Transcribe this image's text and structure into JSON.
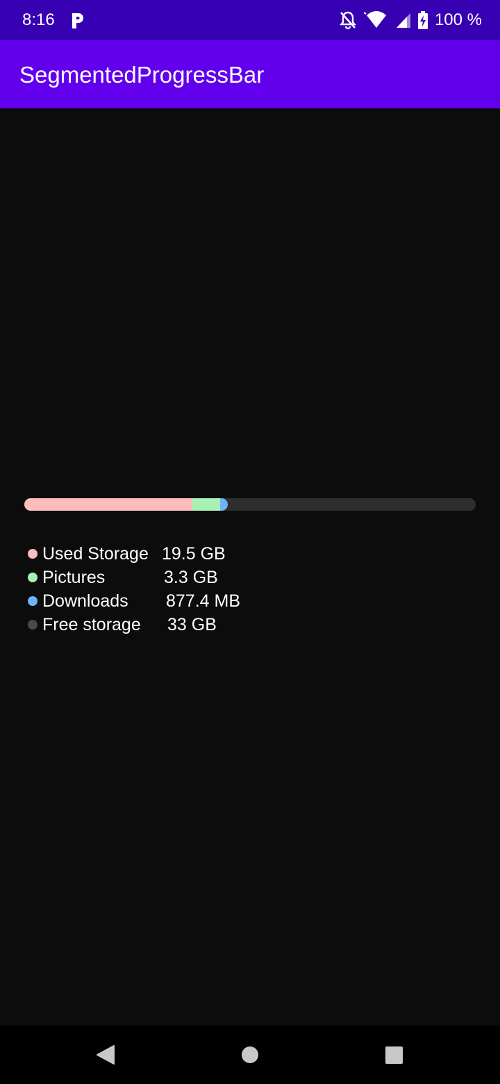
{
  "status_bar": {
    "time": "8:16",
    "battery": "100 %",
    "icons": [
      "parking-icon",
      "notifications-off-icon",
      "wifi-icon",
      "signal-icon",
      "battery-charging-icon"
    ]
  },
  "app_bar": {
    "title": "SegmentedProgressBar",
    "color": "#6200ee",
    "status_color": "#3700b3"
  },
  "progress": {
    "segments": [
      {
        "name": "Used Storage",
        "fraction": 0.3716,
        "color": "#ffbcbc"
      },
      {
        "name": "Pictures",
        "fraction": 0.0629,
        "color": "#a8f0b4"
      },
      {
        "name": "Downloads",
        "fraction": 0.0167,
        "color": "#6fb3f7"
      },
      {
        "name": "Free storage",
        "fraction": 0.6289,
        "color": "#2e2e2e"
      }
    ]
  },
  "legend": {
    "items": [
      {
        "label": "Used Storage",
        "value": "19.5 GB",
        "color": "#ffbcbc"
      },
      {
        "label": "Pictures",
        "value": "3.3 GB",
        "color": "#a8f0b4"
      },
      {
        "label": "Downloads",
        "value": "877.4 MB",
        "color": "#6fb3f7"
      },
      {
        "label": "Free storage",
        "value": "33 GB",
        "color": "#4a4a4a"
      }
    ]
  },
  "nav_bar": {
    "buttons": [
      "back-icon",
      "home-icon",
      "recents-icon"
    ]
  }
}
